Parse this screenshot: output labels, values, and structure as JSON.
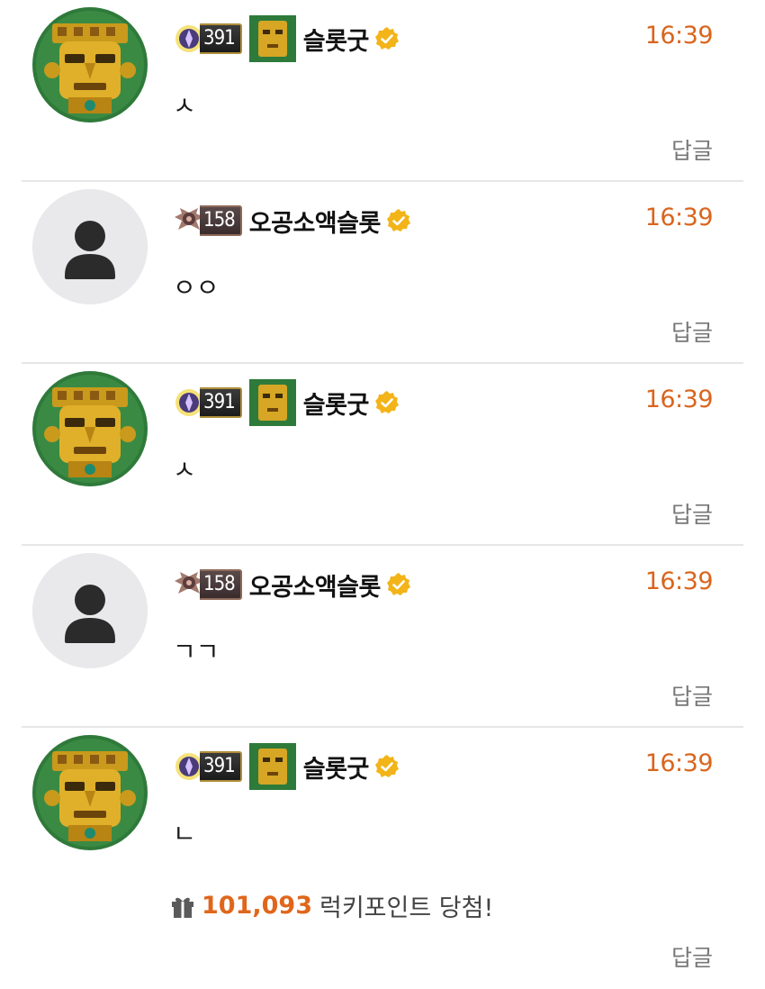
{
  "comments": [
    {
      "user": {
        "nickname": "슬롯굿",
        "level": "391",
        "avatar": "aztec-mask",
        "has_title_icon": true
      },
      "time": "16:39",
      "text": "ㅅ",
      "reply_label": "답글"
    },
    {
      "user": {
        "nickname": "오공소액슬롯",
        "level": "158",
        "avatar": "default-person",
        "has_title_icon": false
      },
      "time": "16:39",
      "text": "ㅇㅇ",
      "reply_label": "답글"
    },
    {
      "user": {
        "nickname": "슬롯굿",
        "level": "391",
        "avatar": "aztec-mask",
        "has_title_icon": true
      },
      "time": "16:39",
      "text": "ㅅ",
      "reply_label": "답글"
    },
    {
      "user": {
        "nickname": "오공소액슬롯",
        "level": "158",
        "avatar": "default-person",
        "has_title_icon": false
      },
      "time": "16:39",
      "text": "ㄱㄱ",
      "reply_label": "답글"
    },
    {
      "user": {
        "nickname": "슬롯굿",
        "level": "391",
        "avatar": "aztec-mask",
        "has_title_icon": true
      },
      "time": "16:39",
      "text": "ㄴ",
      "lucky": {
        "amount": "101,093",
        "label": "럭키포인트 당첨!",
        "icon": "gift-icon"
      },
      "reply_label": "답글"
    }
  ],
  "colors": {
    "time": "#d9651e",
    "lucky_amount": "#e0661b",
    "verified": "#f2b418",
    "divider": "#e6e6e6"
  }
}
